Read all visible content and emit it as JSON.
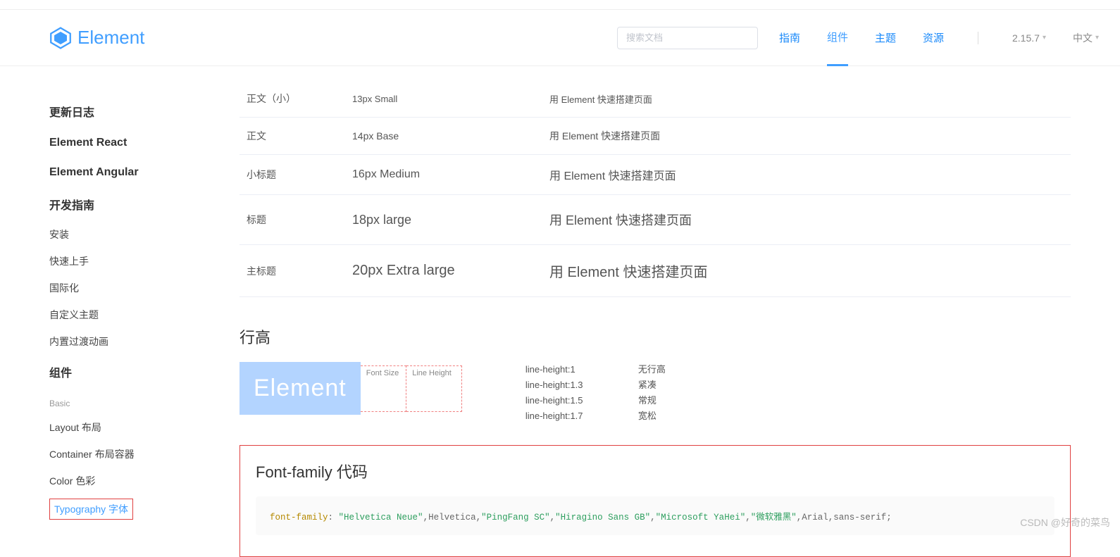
{
  "header": {
    "logo_text": "Element",
    "search_placeholder": "搜索文档",
    "nav": {
      "guide": "指南",
      "component": "组件",
      "theme": "主题",
      "resource": "资源"
    },
    "version": "2.15.7",
    "lang": "中文"
  },
  "sidebar": {
    "changelog": "更新日志",
    "react": "Element React",
    "angular": "Element Angular",
    "dev_guide": "开发指南",
    "install": "安装",
    "quick": "快速上手",
    "i18n": "国际化",
    "custom_theme": "自定义主题",
    "transition": "内置过渡动画",
    "components": "组件",
    "basic": "Basic",
    "layout": "Layout 布局",
    "container": "Container 布局容器",
    "color": "Color 色彩",
    "typography": "Typography 字体"
  },
  "table": {
    "rows": [
      {
        "label": "正文（小）",
        "size": "13px Small",
        "sample": "用 Element 快速搭建页面",
        "cls": "fs-13"
      },
      {
        "label": "正文",
        "size": "14px Base",
        "sample": "用 Element 快速搭建页面",
        "cls": "fs-14"
      },
      {
        "label": "小标题",
        "size": "16px Medium",
        "sample": "用 Element 快速搭建页面",
        "cls": "fs-16"
      },
      {
        "label": "标题",
        "size": "18px large",
        "sample": "用 Element 快速搭建页面",
        "cls": "fs-18 big"
      },
      {
        "label": "主标题",
        "size": "20px Extra large",
        "sample": "用 Element 快速搭建页面",
        "cls": "fs-20 big"
      }
    ]
  },
  "lineheight": {
    "title": "行高",
    "box_text": "Element",
    "mark1": "Font Size",
    "mark2": "Line Height",
    "rows": [
      {
        "k": "line-height:1",
        "v": "无行高"
      },
      {
        "k": "line-height:1.3",
        "v": "紧凑"
      },
      {
        "k": "line-height:1.5",
        "v": "常规"
      },
      {
        "k": "line-height:1.7",
        "v": "宽松"
      }
    ]
  },
  "fontfamily": {
    "title": "Font-family 代码",
    "code_prop": "font-family",
    "code_sep1": ": ",
    "code_s1": "\"Helvetica Neue\"",
    "code_c1": ",Helvetica,",
    "code_s2": "\"PingFang SC\"",
    "code_c2": ",",
    "code_s3": "\"Hiragino Sans GB\"",
    "code_c3": ",",
    "code_s4": "\"Microsoft YaHei\"",
    "code_c4": ",",
    "code_s5": "\"微软雅黑\"",
    "code_c5": ",Arial,sans-serif;"
  },
  "watermark": "CSDN @好奇的菜鸟"
}
